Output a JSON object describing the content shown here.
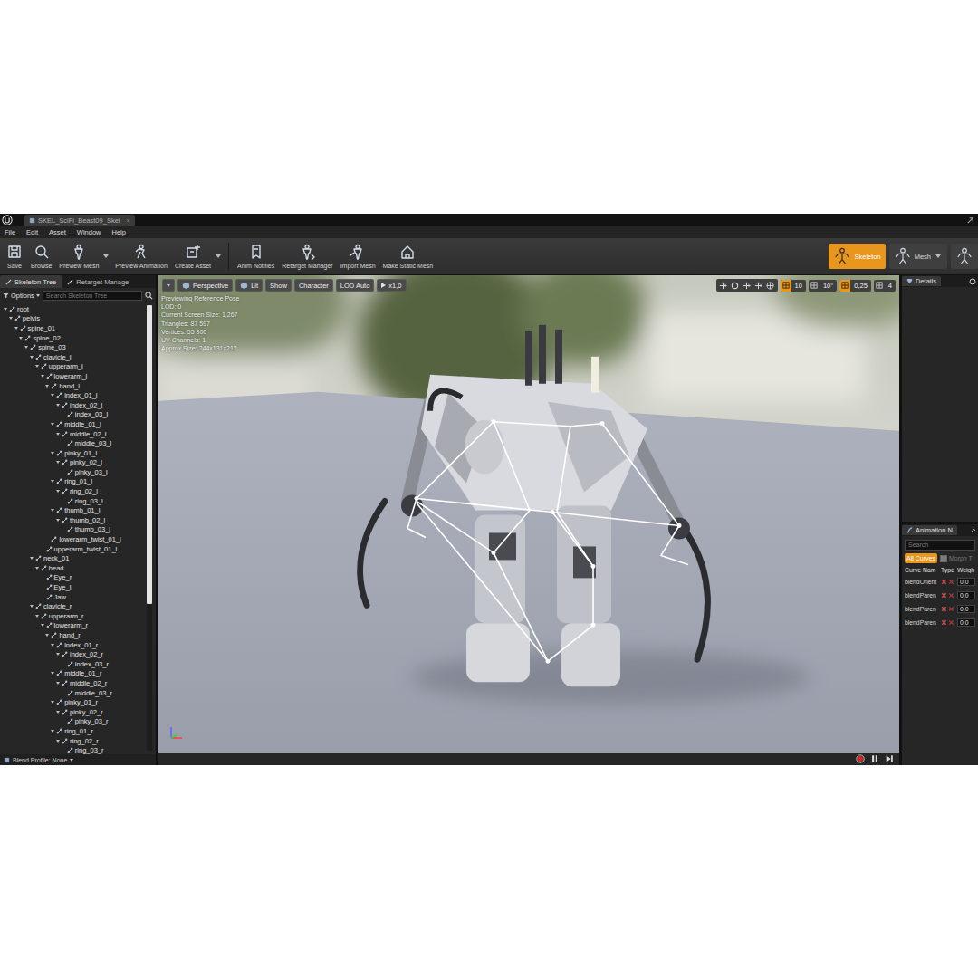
{
  "window": {
    "tab_title": "SKEL_SciFi_Beast09_Skel",
    "tab_close": "×"
  },
  "menu": [
    "File",
    "Edit",
    "Asset",
    "Window",
    "Help"
  ],
  "toolbar": {
    "groups": [
      [
        {
          "label": "Save",
          "dropdown": false
        },
        {
          "label": "Browse",
          "dropdown": false
        },
        {
          "label": "Preview Mesh",
          "dropdown": true
        },
        {
          "label": "Preview Animation",
          "dropdown": false
        },
        {
          "label": "Create Asset",
          "dropdown": true
        }
      ],
      [
        {
          "label": "Anim Notifies",
          "dropdown": false
        },
        {
          "label": "Retarget Manager",
          "dropdown": false
        },
        {
          "label": "Import Mesh",
          "dropdown": false
        },
        {
          "label": "Make Static Mesh",
          "dropdown": false
        }
      ]
    ],
    "modes": [
      {
        "label": "Skeleton",
        "selected": true,
        "dropdown": false
      },
      {
        "label": "Mesh",
        "selected": false,
        "dropdown": true
      },
      {
        "label": "",
        "selected": false,
        "dropdown": false
      }
    ]
  },
  "skeleton": {
    "tabs": [
      {
        "label": "Skeleton Tree",
        "selected": true
      },
      {
        "label": "Retarget Manage",
        "selected": false
      }
    ],
    "options": "Options",
    "search_placeholder": "Search Skeleton Tree",
    "scrollbar": {
      "level": 0.67
    },
    "bones": [
      {
        "name": "root",
        "depth": 0,
        "has_children": true
      },
      {
        "name": "pelvis",
        "depth": 1,
        "has_children": true
      },
      {
        "name": "spine_01",
        "depth": 2,
        "has_children": true
      },
      {
        "name": "spine_02",
        "depth": 3,
        "has_children": true
      },
      {
        "name": "spine_03",
        "depth": 4,
        "has_children": true
      },
      {
        "name": "clavicle_l",
        "depth": 5,
        "has_children": true
      },
      {
        "name": "upperarm_l",
        "depth": 6,
        "has_children": true
      },
      {
        "name": "lowerarm_l",
        "depth": 7,
        "has_children": true
      },
      {
        "name": "hand_l",
        "depth": 8,
        "has_children": true
      },
      {
        "name": "index_01_l",
        "depth": 9,
        "has_children": true
      },
      {
        "name": "index_02_l",
        "depth": 10,
        "has_children": true
      },
      {
        "name": "index_03_l",
        "depth": 11,
        "has_children": false
      },
      {
        "name": "middle_01_l",
        "depth": 9,
        "has_children": true
      },
      {
        "name": "middle_02_l",
        "depth": 10,
        "has_children": true
      },
      {
        "name": "middle_03_l",
        "depth": 11,
        "has_children": false
      },
      {
        "name": "pinky_01_l",
        "depth": 9,
        "has_children": true
      },
      {
        "name": "pinky_02_l",
        "depth": 10,
        "has_children": true
      },
      {
        "name": "pinky_03_l",
        "depth": 11,
        "has_children": false
      },
      {
        "name": "ring_01_l",
        "depth": 9,
        "has_children": true
      },
      {
        "name": "ring_02_l",
        "depth": 10,
        "has_children": true
      },
      {
        "name": "ring_03_l",
        "depth": 11,
        "has_children": false
      },
      {
        "name": "thumb_01_l",
        "depth": 9,
        "has_children": true
      },
      {
        "name": "thumb_02_l",
        "depth": 10,
        "has_children": true
      },
      {
        "name": "thumb_03_l",
        "depth": 11,
        "has_children": false
      },
      {
        "name": "lowerarm_twist_01_l",
        "depth": 8,
        "has_children": false
      },
      {
        "name": "upperarm_twist_01_l",
        "depth": 7,
        "has_children": false
      },
      {
        "name": "neck_01",
        "depth": 5,
        "has_children": true
      },
      {
        "name": "head",
        "depth": 6,
        "has_children": true
      },
      {
        "name": "Eye_r",
        "depth": 7,
        "has_children": false
      },
      {
        "name": "Eye_l",
        "depth": 7,
        "has_children": false
      },
      {
        "name": "Jaw",
        "depth": 7,
        "has_children": false
      },
      {
        "name": "clavicle_r",
        "depth": 5,
        "has_children": true
      },
      {
        "name": "upperarm_r",
        "depth": 6,
        "has_children": true
      },
      {
        "name": "lowerarm_r",
        "depth": 7,
        "has_children": true
      },
      {
        "name": "hand_r",
        "depth": 8,
        "has_children": true
      },
      {
        "name": "index_01_r",
        "depth": 9,
        "has_children": true
      },
      {
        "name": "index_02_r",
        "depth": 10,
        "has_children": true
      },
      {
        "name": "index_03_r",
        "depth": 11,
        "has_children": false
      },
      {
        "name": "middle_01_r",
        "depth": 9,
        "has_children": true
      },
      {
        "name": "middle_02_r",
        "depth": 10,
        "has_children": true
      },
      {
        "name": "middle_03_r",
        "depth": 11,
        "has_children": false
      },
      {
        "name": "pinky_01_r",
        "depth": 9,
        "has_children": true
      },
      {
        "name": "pinky_02_r",
        "depth": 10,
        "has_children": true
      },
      {
        "name": "pinky_03_r",
        "depth": 11,
        "has_children": false
      },
      {
        "name": "ring_01_r",
        "depth": 9,
        "has_children": true
      },
      {
        "name": "ring_02_r",
        "depth": 10,
        "has_children": true
      },
      {
        "name": "ring_03_r",
        "depth": 11,
        "has_children": false
      }
    ],
    "blend_profile": "Blend Profile: None"
  },
  "viewport": {
    "toolbar_left": [
      {
        "label": "Perspective",
        "kind": "icon-label"
      },
      {
        "label": "Lit",
        "kind": "icon-label"
      },
      {
        "label": "Show",
        "kind": "label"
      },
      {
        "label": "Character",
        "kind": "label"
      },
      {
        "label": "LOD Auto",
        "kind": "label"
      },
      {
        "label": "x1,0",
        "kind": "play-label"
      }
    ],
    "toolbar_right": [
      {
        "label": "10",
        "active": true
      },
      {
        "label": "10°",
        "active": false
      },
      {
        "label": "0,25",
        "active": true
      },
      {
        "label": "4",
        "active": false
      }
    ],
    "info": [
      "Previewing Reference Pose",
      "LOD: 0",
      "Current Screen Size: 1,267",
      "Triangles: 87 597",
      "Vertices: 55 800",
      "UV Channels: 1",
      "Approx Size: 244x131x212"
    ]
  },
  "details": {
    "tab": "Details"
  },
  "curves": {
    "tab": "Animation N",
    "search_placeholder": "Search",
    "filter": {
      "label": "All Curves",
      "selected": true
    },
    "morph": {
      "label": "Morph T",
      "checked": true,
      "disabled": true
    },
    "columns": [
      "Curve Nam",
      "Type",
      "Weigh"
    ],
    "rows": [
      {
        "name": "blendOrient",
        "value": "0,0"
      },
      {
        "name": "blendParen",
        "value": "0,0"
      },
      {
        "name": "blendParen",
        "value": "0,0"
      },
      {
        "name": "blendParen",
        "value": "0,0"
      }
    ]
  }
}
